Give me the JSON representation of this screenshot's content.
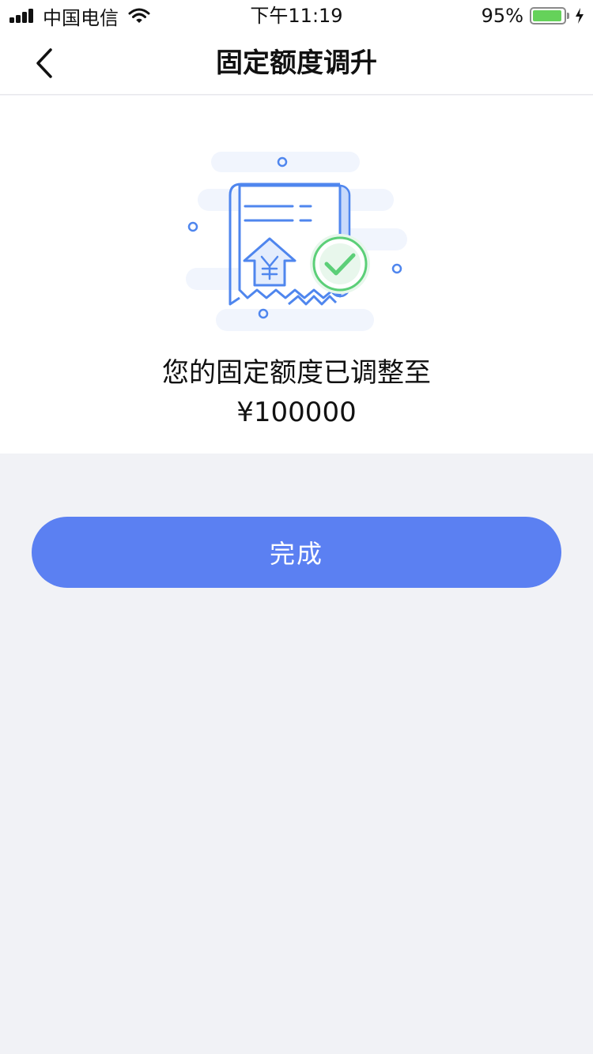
{
  "status_bar": {
    "carrier": "中国电信",
    "time": "下午11:19",
    "battery_percent": "95%",
    "battery_level": 0.95,
    "signal_bars": 4
  },
  "nav": {
    "title": "固定额度调升",
    "back_icon": "chevron-left-icon"
  },
  "result": {
    "illustration": "receipt-success-illustration",
    "message": "您的固定额度已调整至",
    "amount": "¥100000"
  },
  "actions": {
    "done_label": "完成"
  },
  "colors": {
    "primary": "#5b80f2",
    "success": "#5ccf78",
    "illustration_blue": "#4f86ee",
    "page_bg": "#f1f2f6"
  }
}
